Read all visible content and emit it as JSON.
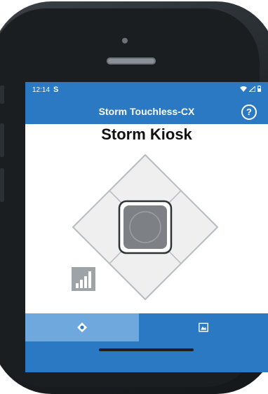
{
  "statusbar": {
    "time": "12:14",
    "notification": "S",
    "icons": [
      "wifi-icon",
      "signal-icon",
      "battery-icon"
    ]
  },
  "appbar": {
    "title": "Storm Touchless-CX",
    "help": "?"
  },
  "main": {
    "title": "Storm Kiosk",
    "pad": {
      "buttons": [
        "up",
        "right",
        "down",
        "left",
        "center"
      ]
    },
    "indicator_icon": "signal-strength-icon"
  },
  "bottom_nav": {
    "tabs": [
      {
        "icon": "navigation-pad-icon",
        "selected": true
      },
      {
        "icon": "image-icon",
        "selected": false
      }
    ]
  },
  "colors": {
    "accent": "#2b79c2",
    "selected_tab": "#6fa8dc",
    "pad_center": "#7d8186"
  }
}
